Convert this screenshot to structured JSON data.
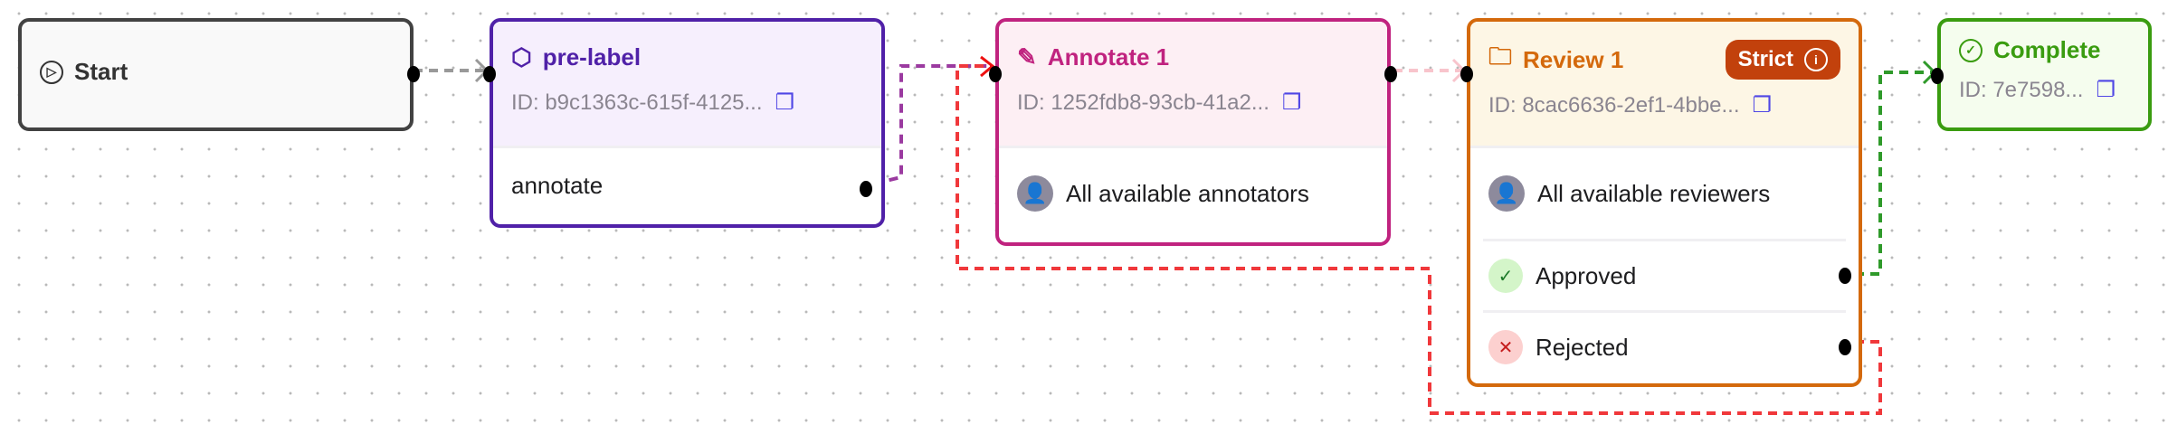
{
  "nodes": {
    "start": {
      "title": "Start",
      "icon": "play-circle-icon"
    },
    "prelabel": {
      "title": "pre-label",
      "id": "ID: b9c1363c-615f-4125...",
      "output": "annotate",
      "color": "#5021a8"
    },
    "annotate": {
      "title": "Annotate 1",
      "id": "ID: 1252fdb8-93cb-41a2...",
      "assignee": "All available annotators",
      "color": "#c0237f"
    },
    "review": {
      "title": "Review 1",
      "badge": "Strict",
      "id": "ID: 8cac6636-2ef1-4bbe...",
      "assignee": "All available reviewers",
      "approved": "Approved",
      "rejected": "Rejected",
      "color": "#d4690c"
    },
    "complete": {
      "title": "Complete",
      "id": "ID: 7e7598...",
      "color": "#3a9c10"
    }
  }
}
